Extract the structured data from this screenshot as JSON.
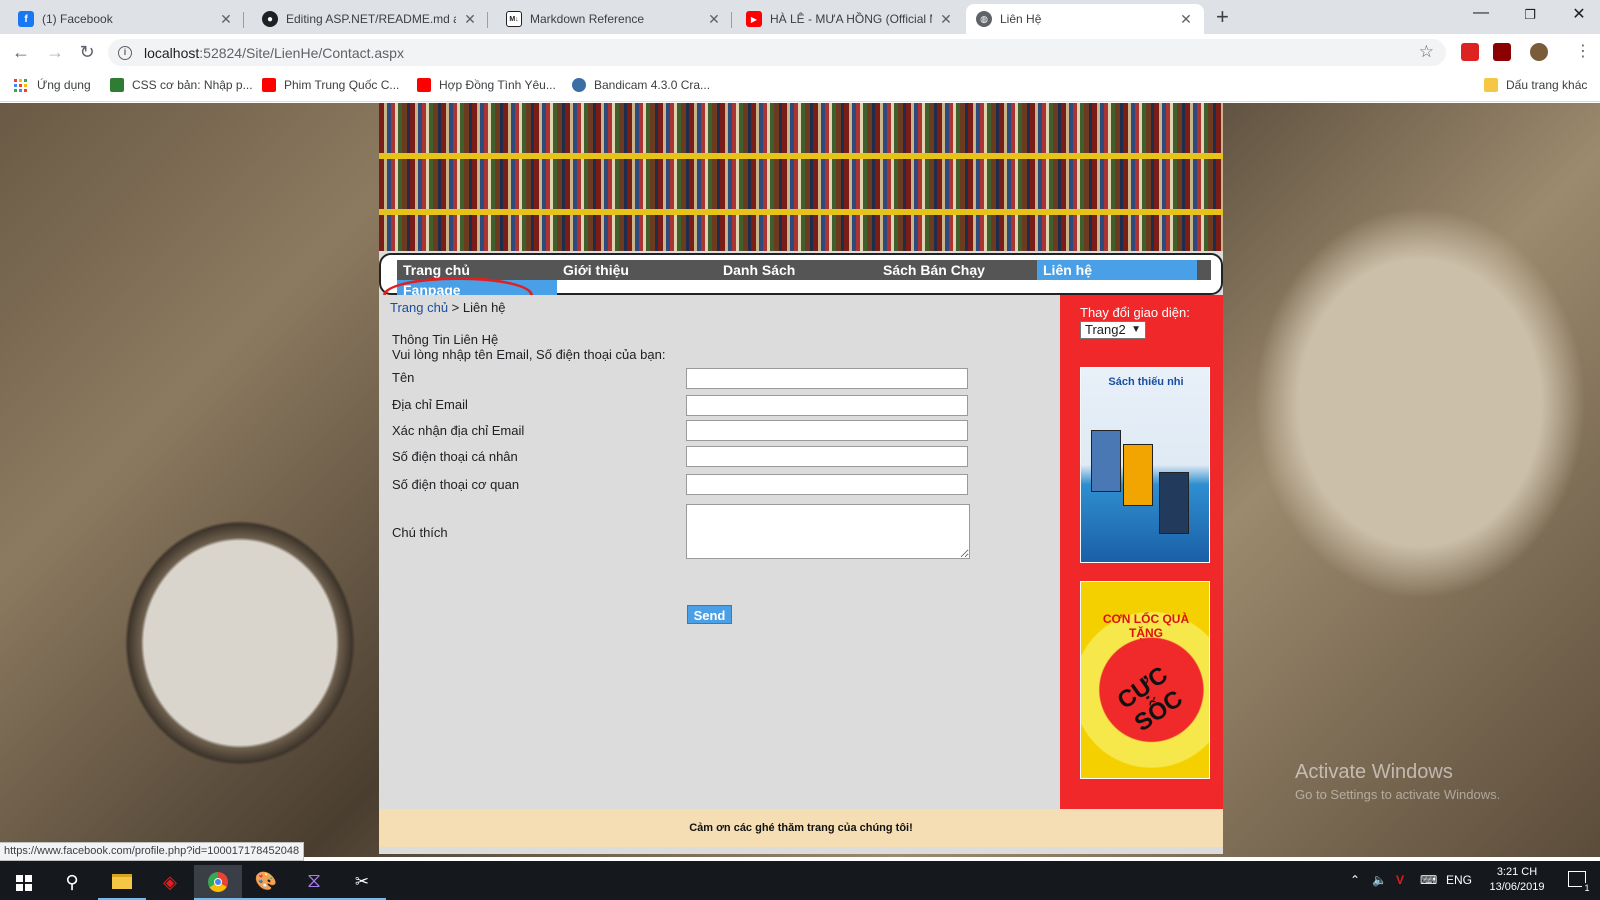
{
  "browser": {
    "tabs": [
      {
        "title": "(1) Facebook",
        "favicon": "facebook-icon",
        "color": "#1877f2"
      },
      {
        "title": "Editing ASP.NET/README.md at",
        "favicon": "github-icon",
        "color": "#202124"
      },
      {
        "title": "Markdown Reference",
        "favicon": "markdown-icon",
        "color": "#202124"
      },
      {
        "title": "HÀ LÊ - MƯA HỒNG (Official MV",
        "favicon": "youtube-icon",
        "color": "#ff0000"
      },
      {
        "title": "Liên Hệ",
        "favicon": "globe-icon",
        "color": "#5f6368",
        "active": true
      }
    ],
    "url_host": "localhost",
    "url_path": ":52824/Site/LienHe/Contact.aspx",
    "bookmarks": [
      {
        "label": "Ứng dụng",
        "icon": "apps-grid-icon"
      },
      {
        "label": "CSS cơ bản: Nhập p...",
        "icon": "bookmark-green-icon"
      },
      {
        "label": "Phim Trung Quốc C...",
        "icon": "youtube-icon"
      },
      {
        "label": "Hợp Đồng Tình Yêu...",
        "icon": "youtube-icon"
      },
      {
        "label": "Bandicam 4.3.0 Cra...",
        "icon": "bandicam-icon"
      }
    ],
    "other_bookmarks": "Dấu trang khác",
    "status_url": "https://www.facebook.com/profile.php?id=100017178452048"
  },
  "site": {
    "menu": [
      {
        "label": "Trang chủ"
      },
      {
        "label": "Giới thiệu"
      },
      {
        "label": "Danh Sách"
      },
      {
        "label": "Sách Bán Chạy"
      },
      {
        "label": "Liên hệ",
        "active": true
      }
    ],
    "submenu_item": "Fanpage",
    "breadcrumb": {
      "home": "Trang chủ",
      "sep": " > ",
      "current": "Liên hệ"
    },
    "form": {
      "heading": "Thông Tin Liên Hệ",
      "instruction": "Vui lòng nhập tên Email, Số điện thoại của bạn:",
      "fields": [
        {
          "label": "Tên",
          "value": ""
        },
        {
          "label": "Địa chỉ Email",
          "value": ""
        },
        {
          "label": "Xác nhận địa chỉ Email",
          "value": ""
        },
        {
          "label": "Số điện thoại cá nhân",
          "value": ""
        },
        {
          "label": "Số điện thoại cơ quan",
          "value": ""
        }
      ],
      "note_label": "Chú thích",
      "note_value": "",
      "send_label": "Send"
    },
    "sidebar": {
      "theme_label": "Thay đổi giao diện:",
      "theme_value": "Trang2",
      "ad1_title": "Sách thiếu nhi",
      "ad2_top": "CƠN LỐC QUÀ TẶNG",
      "ad2_main": "CỰC SỐC"
    },
    "footer": "Cảm ơn các ghé thăm trang của chúng tôi!"
  },
  "desktop": {
    "watermark": "Activate Windows",
    "watermark_sub": "Go to Settings to activate Windows.",
    "taskbar": {
      "lang": "ENG",
      "time": "3:21 CH",
      "date": "13/06/2019",
      "notif_count": "1"
    }
  },
  "colors": {
    "menu_active": "#4aa0e6",
    "sidebar_bg": "#f0282a",
    "footer_bg": "#f5deb3",
    "highlight_circle": "#e02020"
  }
}
